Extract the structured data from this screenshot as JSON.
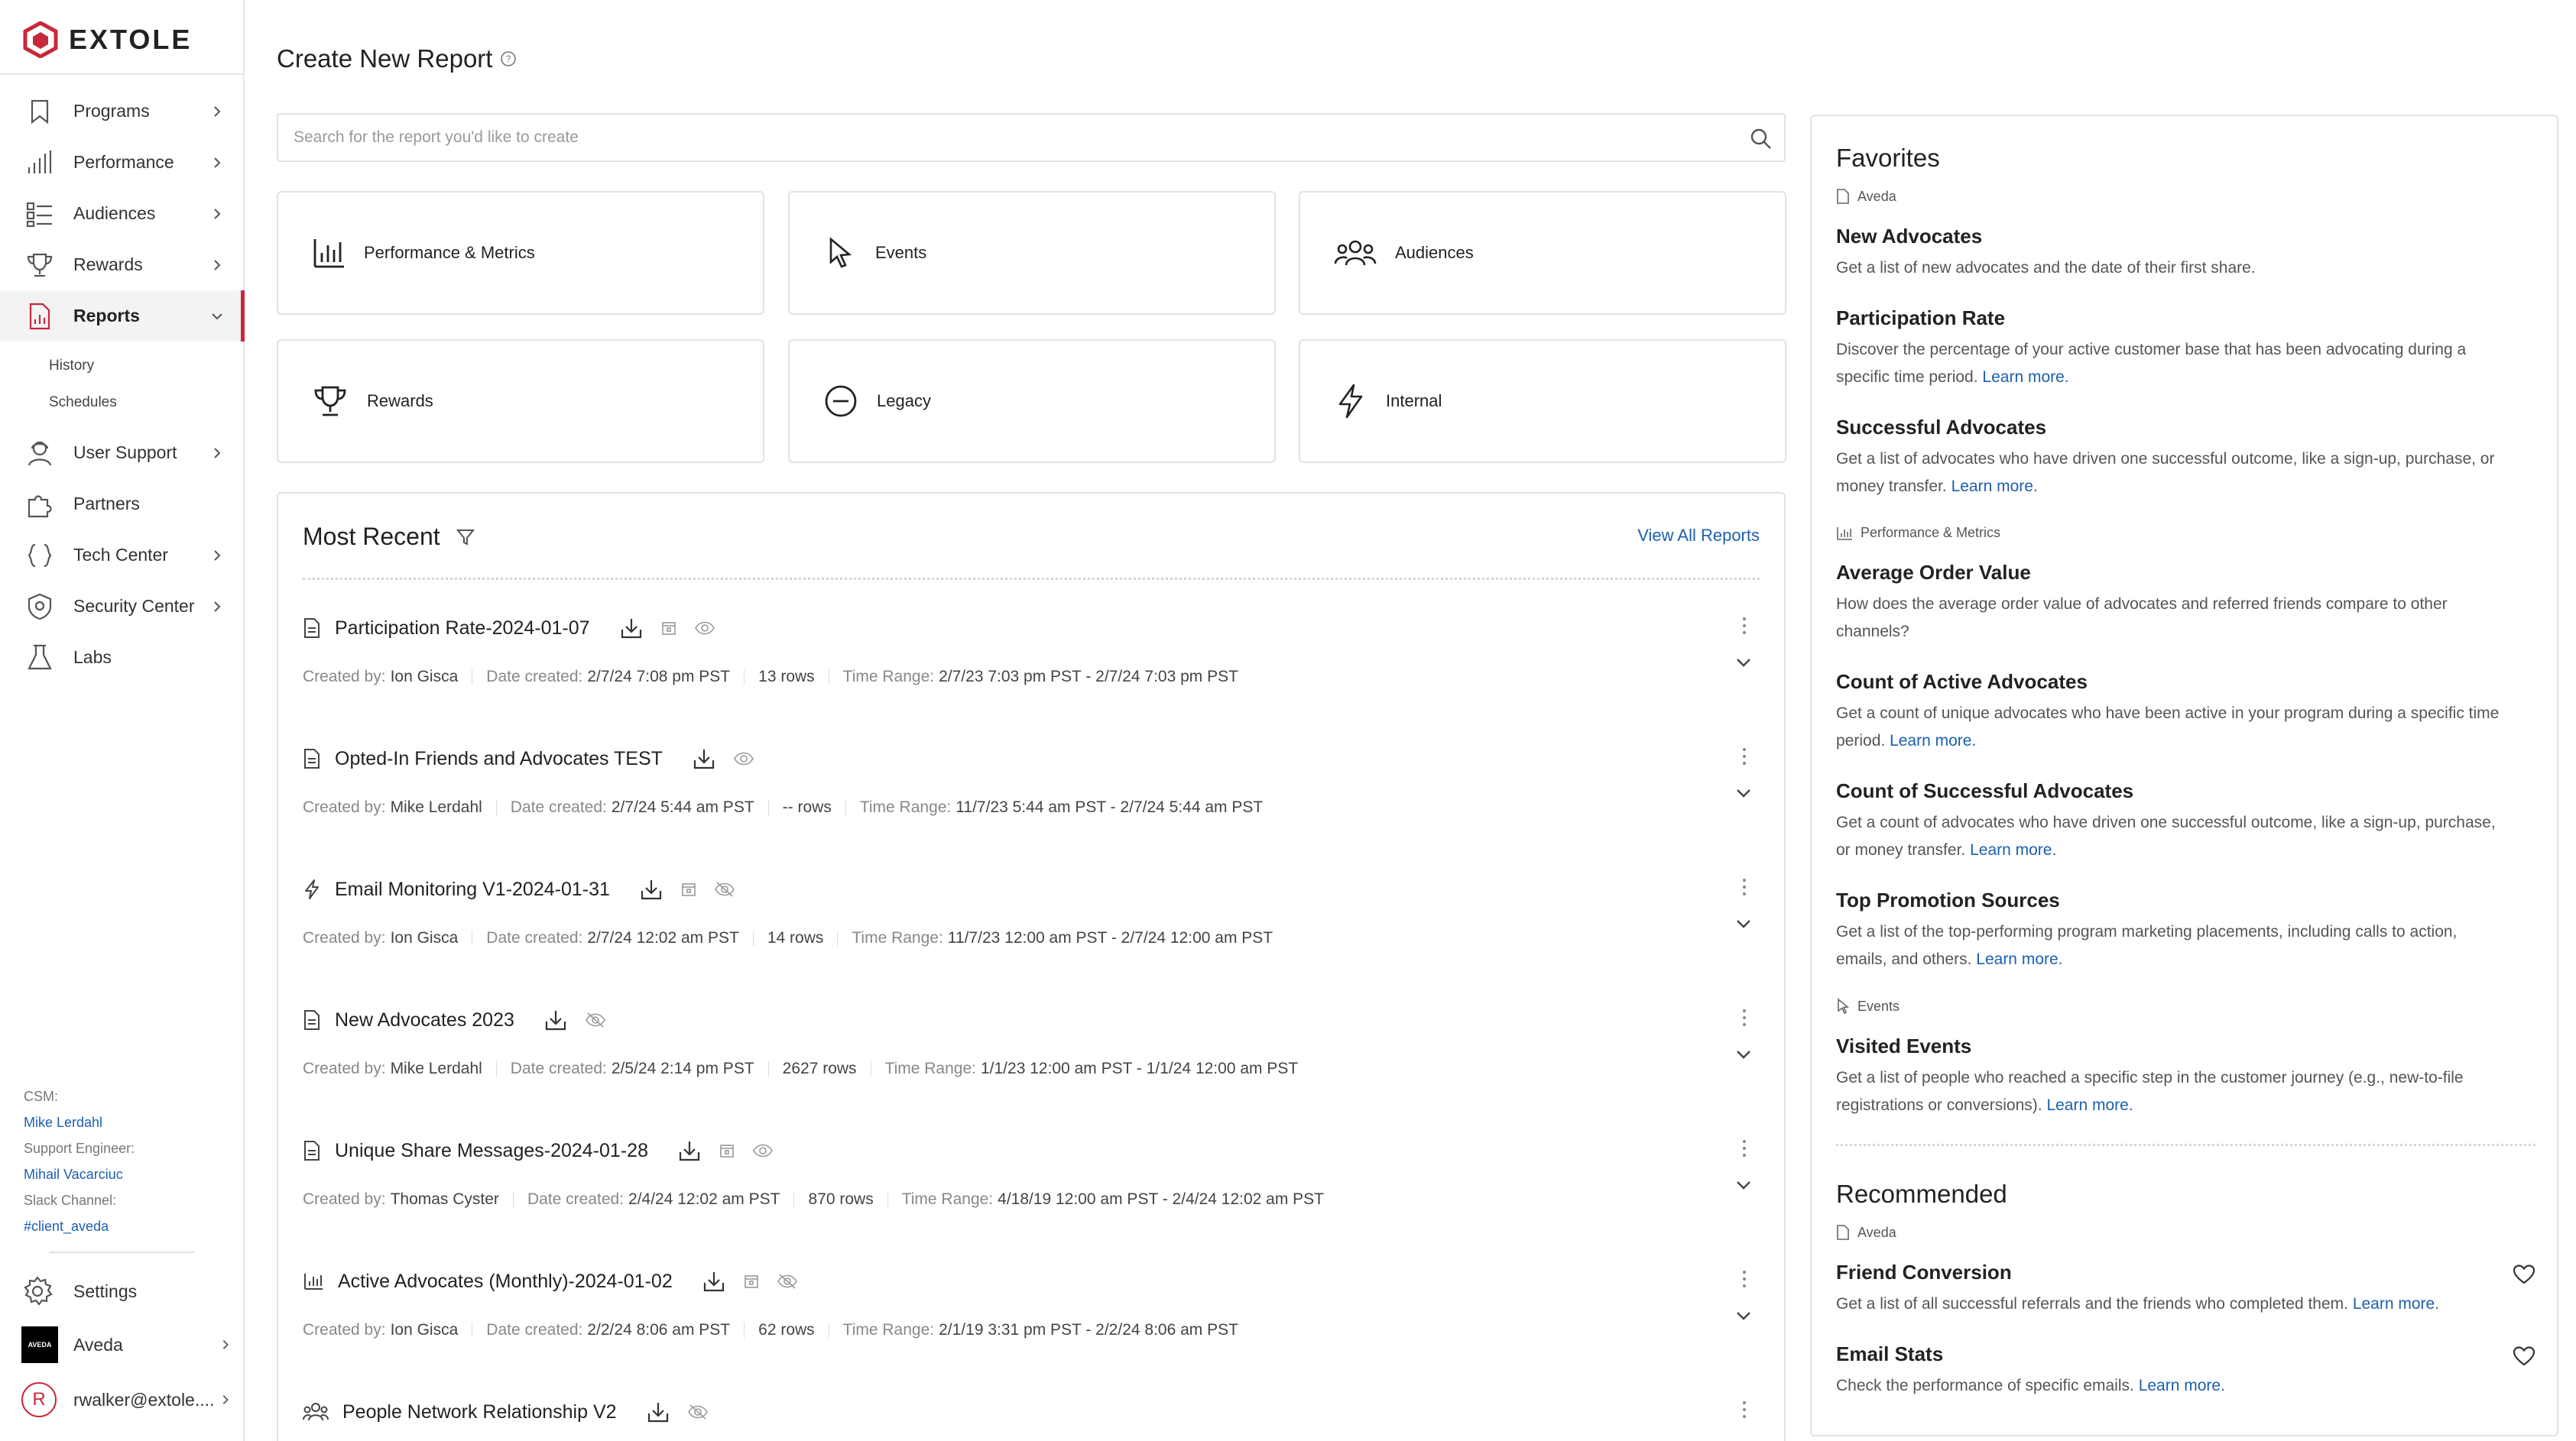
{
  "brand": {
    "name": "EXTOLE",
    "accent": "#c8283c",
    "link": "#1c5fb0"
  },
  "sidebar": {
    "items": [
      {
        "label": "Programs",
        "icon": "bookmark-icon"
      },
      {
        "label": "Performance",
        "icon": "bar-chart-icon"
      },
      {
        "label": "Audiences",
        "icon": "audience-icon"
      },
      {
        "label": "Rewards",
        "icon": "trophy-icon"
      },
      {
        "label": "Reports",
        "icon": "report-icon"
      },
      {
        "label": "User Support",
        "icon": "support-icon"
      },
      {
        "label": "Partners",
        "icon": "puzzle-icon"
      },
      {
        "label": "Tech Center",
        "icon": "braces-icon"
      },
      {
        "label": "Security Center",
        "icon": "shield-icon"
      },
      {
        "label": "Labs",
        "icon": "flask-icon"
      }
    ],
    "subitems": [
      {
        "label": "History"
      },
      {
        "label": "Schedules"
      }
    ],
    "meta": {
      "csm_label": "CSM:",
      "csm_value": "Mike Lerdahl",
      "engineer_label": "Support Engineer:",
      "engineer_value": "Mihail Vacarciuc",
      "slack_label": "Slack Channel:",
      "slack_value": "#client_aveda"
    },
    "settings_label": "Settings",
    "client": {
      "name": "Aveda",
      "logo_text": "AVEDA"
    },
    "user": {
      "email": "rwalker@extole....",
      "initial": "R"
    }
  },
  "header": {
    "title": "Create New Report"
  },
  "search": {
    "placeholder": "Search for the report you'd like to create",
    "value": ""
  },
  "categories": [
    {
      "label": "Performance & Metrics",
      "icon": "bar-chart-icon"
    },
    {
      "label": "Events",
      "icon": "cursor-icon"
    },
    {
      "label": "Audiences",
      "icon": "audience-icon"
    },
    {
      "label": "Rewards",
      "icon": "trophy-icon"
    },
    {
      "label": "Legacy",
      "icon": "minus-circle-icon"
    },
    {
      "label": "Internal",
      "icon": "lightning-icon"
    }
  ],
  "recent": {
    "title": "Most Recent",
    "view_all": "View All Reports",
    "labels": {
      "created_by": "Created by:",
      "date_created": "Date created:",
      "time_range": "Time Range:"
    },
    "reports": [
      {
        "name": "Participation Rate-2024-01-07",
        "icon": "document-icon",
        "created_by": "Ion Gisca",
        "date_created": "2/7/24 7:08 pm PST",
        "rows": "13 rows",
        "time_range": "2/7/23 7:03 pm PST - 2/7/24 7:03 pm PST"
      },
      {
        "name": "Opted-In Friends and Advocates TEST",
        "icon": "document-icon",
        "created_by": "Mike Lerdahl",
        "date_created": "2/7/24 5:44 am PST",
        "rows": "-- rows",
        "time_range": "11/7/23 5:44 am PST - 2/7/24 5:44 am PST"
      },
      {
        "name": "Email Monitoring V1-2024-01-31",
        "icon": "lightning-icon",
        "created_by": "Ion Gisca",
        "date_created": "2/7/24 12:02 am PST",
        "rows": "14 rows",
        "time_range": "11/7/23 12:00 am PST - 2/7/24 12:00 am PST"
      },
      {
        "name": "New Advocates 2023",
        "icon": "document-icon",
        "created_by": "Mike Lerdahl",
        "date_created": "2/5/24 2:14 pm PST",
        "rows": "2627 rows",
        "time_range": "1/1/23 12:00 am PST - 1/1/24 12:00 am PST"
      },
      {
        "name": "Unique Share Messages-2024-01-28",
        "icon": "document-icon",
        "created_by": "Thomas Cyster",
        "date_created": "2/4/24 12:02 am PST",
        "rows": "870 rows",
        "time_range": "4/18/19 12:00 am PST - 2/4/24 12:02 am PST"
      },
      {
        "name": "Active Advocates (Monthly)-2024-01-02",
        "icon": "bar-chart-icon",
        "created_by": "Ion Gisca",
        "date_created": "2/2/24 8:06 am PST",
        "rows": "62 rows",
        "time_range": "2/1/19 3:31 pm PST - 2/2/24 8:06 am PST"
      },
      {
        "name": "People Network Relationship V2",
        "icon": "audience-icon",
        "created_by": "",
        "date_created": "",
        "rows": "",
        "time_range": ""
      }
    ]
  },
  "panel": {
    "favorites_title": "Favorites",
    "recommended_title": "Recommended",
    "learn_more": "Learn more.",
    "sections": {
      "aveda": "Aveda",
      "performance": "Performance & Metrics",
      "events": "Events"
    },
    "fav_aveda": [
      {
        "title": "New Advocates",
        "desc": "Get a list of new advocates and the date of their first share.",
        "learn": false
      },
      {
        "title": "Participation Rate",
        "desc": "Discover the percentage of your active customer base that has been advocating during a specific time period.",
        "learn": true
      },
      {
        "title": "Successful Advocates",
        "desc": "Get a list of advocates who have driven one successful outcome, like a sign-up, purchase, or money transfer.",
        "learn": true
      }
    ],
    "fav_performance": [
      {
        "title": "Average Order Value",
        "desc": "How does the average order value of advocates and referred friends compare to other channels?",
        "learn": false
      },
      {
        "title": "Count of Active Advocates",
        "desc": "Get a count of unique advocates who have been active in your program during a specific time period.",
        "learn": true
      },
      {
        "title": "Count of Successful Advocates",
        "desc": "Get a count of advocates who have driven one successful outcome, like a sign-up, purchase, or money transfer.",
        "learn": true
      },
      {
        "title": "Top Promotion Sources",
        "desc": "Get a list of the top-performing program marketing placements, including calls to action, emails, and others.",
        "learn": true
      }
    ],
    "fav_events": [
      {
        "title": "Visited Events",
        "desc": "Get a list of people who reached a specific step in the customer journey (e.g., new-to-file registrations or conversions).",
        "learn": true
      }
    ],
    "recommended": [
      {
        "title": "Friend Conversion",
        "desc": "Get a list of all successful referrals and the friends who completed them.",
        "learn": true
      },
      {
        "title": "Email Stats",
        "desc": "Check the performance of specific emails.",
        "learn": true
      }
    ]
  }
}
